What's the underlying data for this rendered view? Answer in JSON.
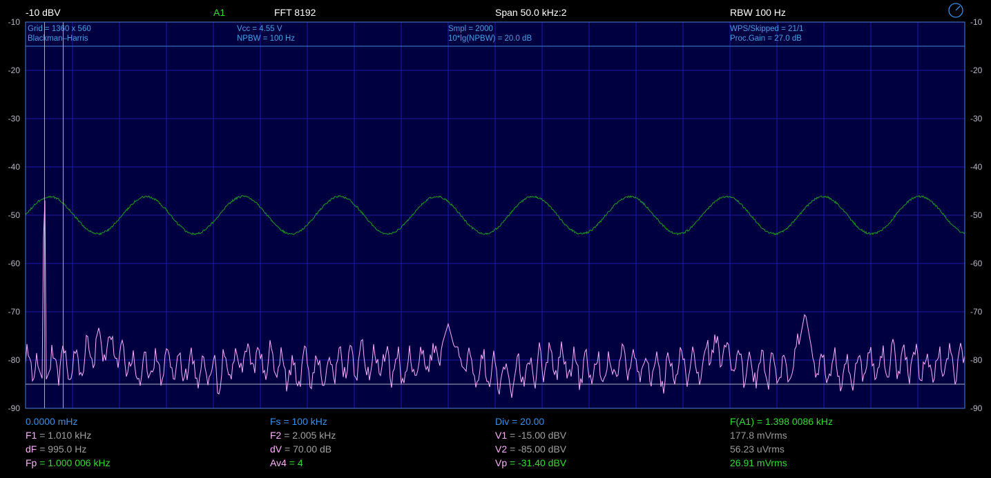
{
  "top": {
    "ref_level": "-10 dBV",
    "channel": "A1",
    "fft": "FFT  8192",
    "span": "Span 50.0 kHz:2",
    "rbw": "RBW 100 Hz"
  },
  "info": {
    "grid": "Grid = 1360 x 560",
    "window": "Blackman–Harris",
    "vcc": "Vcc = 4.55 V",
    "npbw": "NPBW = 100 Hz",
    "smpl": "Smpl = 2000",
    "npbw_db": "10*lg(NPBW) = 20.0 dB",
    "wps": "WPS/Skipped  = 21/1",
    "proc_gain": "Proc.Gain = 27.0 dB"
  },
  "y_ticks": [
    "-10",
    "-20",
    "-30",
    "-40",
    "-50",
    "-60",
    "-70",
    "-80",
    "-90"
  ],
  "bottom": {
    "row1": {
      "start_freq": "0.0000 mHz",
      "fs": "Fs = 100 kHz",
      "div": "Div = 20.00",
      "fa1_label": "F(A1)",
      "fa1_value": " = 1.398 0086 kHz"
    },
    "row2": {
      "f1_label": "F1",
      "f1_value": " = 1.010 kHz",
      "f2_label": "F2",
      "f2_value": " = 2.005 kHz",
      "v1_label": "V1",
      "v1_value": " = -15.00 dBV",
      "rms1": "177.8 mVrms"
    },
    "row3": {
      "df_label": "dF",
      "df_value": " = 995.0 Hz",
      "dv_label": "dV",
      "dv_value": " = 70.00 dB",
      "v2_label": "V2",
      "v2_value": " = -85.00 dBV",
      "rms2": "56.23 uVrms"
    },
    "row4": {
      "fp_label": "Fp",
      "fp_value": " = 1.000 006 kHz",
      "av_label": "Av4",
      "av_value": " = 4",
      "vp_label": "Vp",
      "vp_value": " = -31.40 dBV",
      "rms3": "26.91 mVrms"
    }
  },
  "colors": {
    "background": "#000000",
    "plot_bg": "#000040",
    "grid": "#1a1aa8",
    "frame": "#4a7fd8",
    "spectrum": "#ffb0ff",
    "waveform": "#1e9a1e",
    "cursor": "#b0b0c8"
  },
  "chart_data": {
    "type": "line",
    "ylim": [
      -90,
      -10
    ],
    "xlim_khz": [
      0,
      50
    ],
    "cursor_f1_khz": 1.01,
    "cursor_f2_khz": 2.005,
    "cursor_v1_dbv": -15.0,
    "cursor_v2_dbv": -85.0,
    "series": [
      {
        "x_khz": [
          0.0,
          0.5,
          0.9,
          1.0,
          1.1,
          1.5,
          2.5,
          4.0,
          6.0,
          8.0,
          10.0,
          12.0,
          14.0,
          16.0,
          18.0,
          20.0,
          22.0,
          22.5,
          23.0,
          24.0,
          26.0,
          28.0,
          30.0,
          32.0,
          34.0,
          36.0,
          36.5,
          38.0,
          40.0,
          41.0,
          41.5,
          42.0,
          44.0,
          46.0,
          48.0,
          50.0
        ],
        "db": [
          -82.0,
          -79.5,
          -84.0,
          -31.5,
          -84.0,
          -80.0,
          -81.5,
          -76.0,
          -82.5,
          -80.0,
          -83.0,
          -79.0,
          -82.5,
          -81.0,
          -80.0,
          -82.0,
          -79.0,
          -72.5,
          -80.0,
          -81.5,
          -83.0,
          -80.0,
          -82.5,
          -81.0,
          -83.0,
          -80.0,
          -77.5,
          -81.0,
          -82.0,
          -80.5,
          -70.0,
          -81.0,
          -82.5,
          -80.0,
          -81.5,
          -80.0
        ]
      },
      {
        "x_khz": [
          0.0,
          50.0
        ],
        "db": [
          -50.0,
          -50.0
        ]
      }
    ]
  }
}
